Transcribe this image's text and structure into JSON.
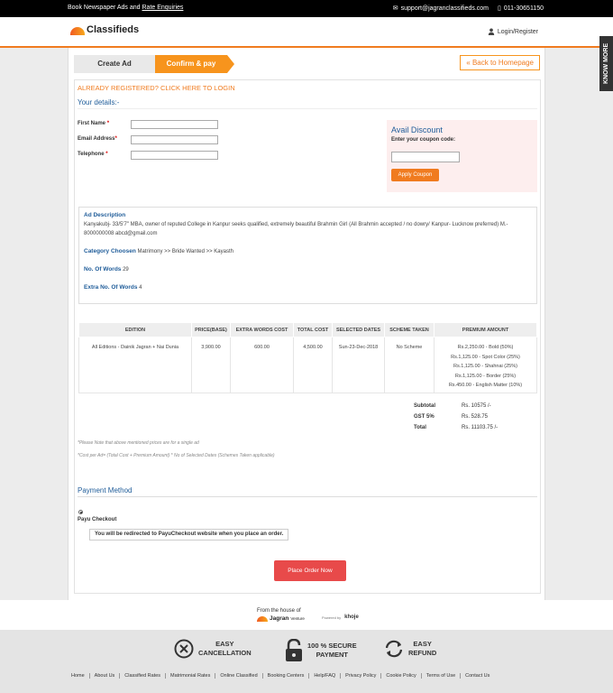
{
  "topbar": {
    "text": "Book Newspaper Ads and ",
    "link": "Rate Enquiries",
    "email": "support@jagranclassifieds.com",
    "phone": "011-30651150"
  },
  "header": {
    "logo_small": "Jagran",
    "logo": "Classifieds",
    "login": "Login/Register"
  },
  "side_tab": "KNOW MORE",
  "steps": [
    "Create Ad",
    "Confirm & pay"
  ],
  "back_button": "« Back to Homepage",
  "already_registered": "ALREADY REGISTERED? CLICK HERE TO LOGIN",
  "your_details": "Your details:-",
  "form": {
    "first_name": "First Name",
    "email": "Email Address",
    "telephone": "Telephone",
    "required": "*",
    "first_name_value": "",
    "email_value": "",
    "telephone_value": ""
  },
  "discount": {
    "title": "Avail Discount",
    "subtitle": "Enter your coupon code:",
    "coupon_value": "",
    "button": "Apply Coupon"
  },
  "ad": {
    "desc_label": "Ad Description",
    "desc": "Kanyakubj- 33/5'7\" MBA, owner of reputed College in Kanpur seeks qualified, extremely beautiful Brahmin Girl (All Brahmin accepted / no dowry/ Kanpur- Lucknow preferred) M.- 8000000008 abcd@gmail.com",
    "category_label": "Category Choosen",
    "category": "Matrimony >> Bride Wanted >> Kayasth",
    "words_label": "No. Of Words",
    "words": "29",
    "extra_label": "Extra No. Of Words",
    "extra": "4"
  },
  "table": {
    "headers": [
      "EDITION",
      "PRICE(BASE)",
      "EXTRA WORDS COST",
      "TOTAL COST",
      "SELECTED DATES",
      "SCHEME TAKEN",
      "PREMIUM AMOUNT"
    ],
    "row": {
      "edition": "All Editions - Dainik Jagran + Nai Dunia",
      "price": "3,900.00",
      "extra": "600.00",
      "total": "4,500.00",
      "dates": "Sun-23-Dec-2018",
      "scheme": "No Scheme",
      "premium": [
        "Rs.2,250.00 - Bold (50%)",
        "Rs.1,125.00 - Spot Color (25%)",
        "Rs.1,125.00 - Shahnai (25%)",
        "Rs.1,125.00 - Border (25%)",
        "Rs.450.00 - English Matter (10%)"
      ]
    }
  },
  "totals": {
    "subtotal_label": "Subtotal",
    "subtotal": "Rs. 10575 /-",
    "gst_label": "GST 5%",
    "gst": "Rs. 528.75",
    "total_label": "Total",
    "total": "Rs. 11103.75 /-"
  },
  "notes": [
    "*Please Note that above mentioned prices are for a single ad",
    "*Cost per Ad= (Total Cost + Premium Amount) * No of Selected Dates (Schemes Taken applicable)"
  ],
  "payment": {
    "title": "Payment Method",
    "option": "Payu Checkout",
    "redirect": "You will be redirected to PayuCheckout website when you place an order.",
    "place_order": "Place Order Now"
  },
  "house": {
    "from": "From the house of",
    "jagran": "Jagran",
    "venture": "Venture",
    "powered": "Powered by",
    "khoj": "khoje"
  },
  "features": [
    {
      "icon": "cancel-icon",
      "line1": "EASY",
      "line2": "CANCELLATION"
    },
    {
      "icon": "lock-icon",
      "line1": "100 % SECURE",
      "line2": "PAYMENT"
    },
    {
      "icon": "refund-icon",
      "line1": "EASY",
      "line2": "REFUND"
    }
  ],
  "footer_links": [
    "Home",
    "About Us",
    "Classified Rates",
    "Matrimonial Rates",
    "Online Classified",
    "Booking Centers",
    "Help/FAQ",
    "Privacy Policy",
    "Cookie Policy",
    "Terms of Use",
    "Contact Us"
  ],
  "colors": {
    "accent": "#f07b1f",
    "link_blue": "#1f5c99",
    "place_order": "#e84a4a"
  }
}
